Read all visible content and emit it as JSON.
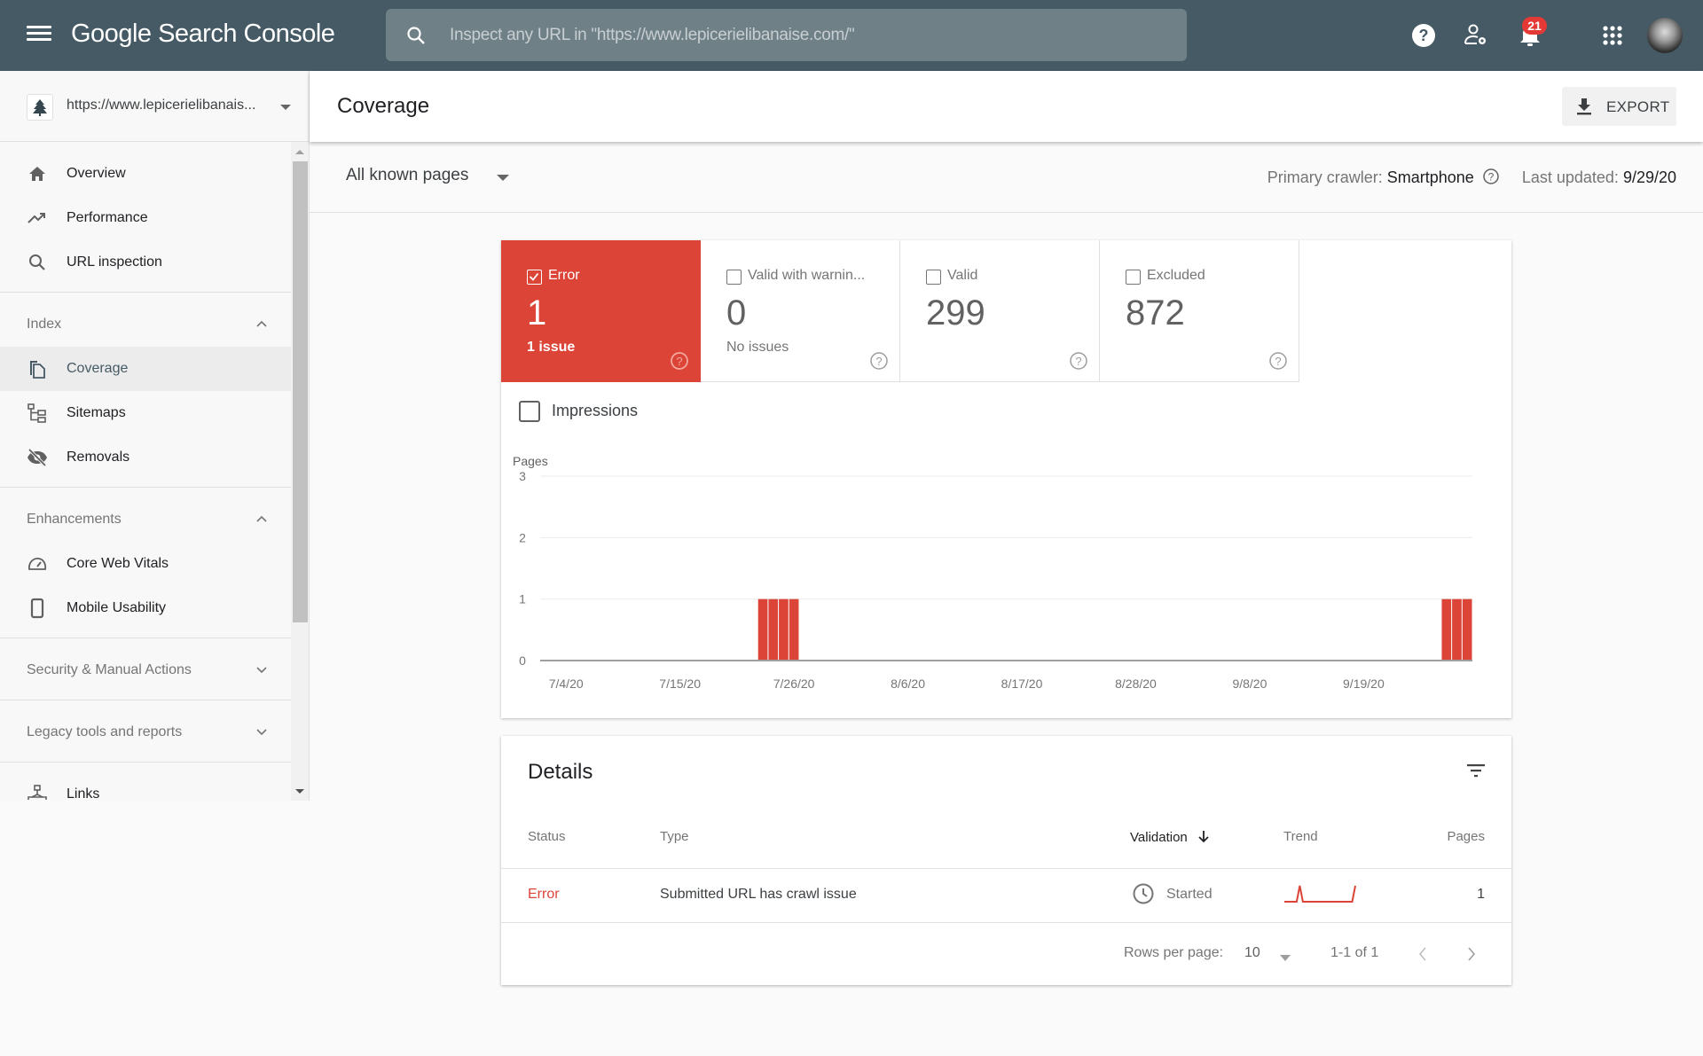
{
  "header": {
    "app_title": "Google Search Console",
    "search_placeholder": "Inspect any URL in \"https://www.lepicerielibanaise.com/\"",
    "notification_count": "21",
    "icons": [
      "menu-icon",
      "search-icon",
      "help-icon",
      "manage-users-icon",
      "notifications-icon",
      "apps-icon",
      "avatar"
    ]
  },
  "sidebar": {
    "property": "https://www.lepicerielibanais...",
    "items": [
      {
        "label": "Overview",
        "icon": "home-icon"
      },
      {
        "label": "Performance",
        "icon": "trending-up-icon"
      },
      {
        "label": "URL inspection",
        "icon": "search-icon"
      }
    ],
    "sections": [
      {
        "label": "Index",
        "expanded": true,
        "items": [
          {
            "label": "Coverage",
            "icon": "coverage-icon",
            "active": true
          },
          {
            "label": "Sitemaps",
            "icon": "sitemap-icon"
          },
          {
            "label": "Removals",
            "icon": "eye-off-icon"
          }
        ]
      },
      {
        "label": "Enhancements",
        "expanded": true,
        "items": [
          {
            "label": "Core Web Vitals",
            "icon": "speedometer-icon"
          },
          {
            "label": "Mobile Usability",
            "icon": "phone-icon"
          }
        ]
      },
      {
        "label": "Security & Manual Actions",
        "expanded": false
      },
      {
        "label": "Legacy tools and reports",
        "expanded": false
      }
    ],
    "bottom_items": [
      {
        "label": "Links",
        "icon": "links-icon"
      }
    ]
  },
  "page": {
    "title": "Coverage",
    "export_label": "EXPORT",
    "pages_filter": "All known pages",
    "crawler_label": "Primary crawler:",
    "crawler_value": "Smartphone",
    "updated_label": "Last updated:",
    "updated_value": "9/29/20"
  },
  "cards": [
    {
      "name": "Error",
      "value": "1",
      "sub": "1 issue",
      "checked": true,
      "color": "#db4437"
    },
    {
      "name": "Valid with warnin...",
      "value": "0",
      "sub": "No issues",
      "checked": false
    },
    {
      "name": "Valid",
      "value": "299",
      "sub": "",
      "checked": false
    },
    {
      "name": "Excluded",
      "value": "872",
      "sub": "",
      "checked": false
    }
  ],
  "impressions_label": "Impressions",
  "chart_data": {
    "type": "bar",
    "title": "",
    "ylabel": "Pages",
    "xlabel": "",
    "ylim": [
      0,
      3
    ],
    "yticks": [
      0,
      1,
      2,
      3
    ],
    "grid": true,
    "x_start": "2020-07-02",
    "x_end": "2020-09-29",
    "xtick_labels": [
      "7/4/20",
      "7/15/20",
      "7/26/20",
      "8/6/20",
      "8/17/20",
      "8/28/20",
      "9/8/20",
      "9/19/20"
    ],
    "xtick_dates": [
      "2020-07-04",
      "2020-07-15",
      "2020-07-26",
      "2020-08-06",
      "2020-08-17",
      "2020-08-28",
      "2020-09-08",
      "2020-09-19"
    ],
    "series": [
      {
        "name": "Error",
        "color": "#db4437",
        "points": [
          {
            "date": "2020-07-23",
            "value": 1
          },
          {
            "date": "2020-07-24",
            "value": 1
          },
          {
            "date": "2020-07-25",
            "value": 1
          },
          {
            "date": "2020-07-26",
            "value": 1
          },
          {
            "date": "2020-09-27",
            "value": 1
          },
          {
            "date": "2020-09-28",
            "value": 1
          },
          {
            "date": "2020-09-29",
            "value": 1
          }
        ]
      }
    ],
    "all_other_days_value": 0
  },
  "details": {
    "title": "Details",
    "columns": [
      "Status",
      "Type",
      "Validation",
      "Trend",
      "Pages"
    ],
    "rows": [
      {
        "status": "Error",
        "type": "Submitted URL has crawl issue",
        "validation": "Started",
        "trend": [
          0,
          0,
          0,
          0,
          0,
          1,
          0,
          0,
          0,
          0,
          0,
          0,
          0,
          0,
          0,
          0,
          0,
          0,
          0,
          0,
          0,
          0,
          0,
          1
        ],
        "pages": "1"
      }
    ],
    "rows_per_page_label": "Rows per page:",
    "rows_per_page": "10",
    "range": "1-1 of 1",
    "status_color": "#db4437"
  }
}
